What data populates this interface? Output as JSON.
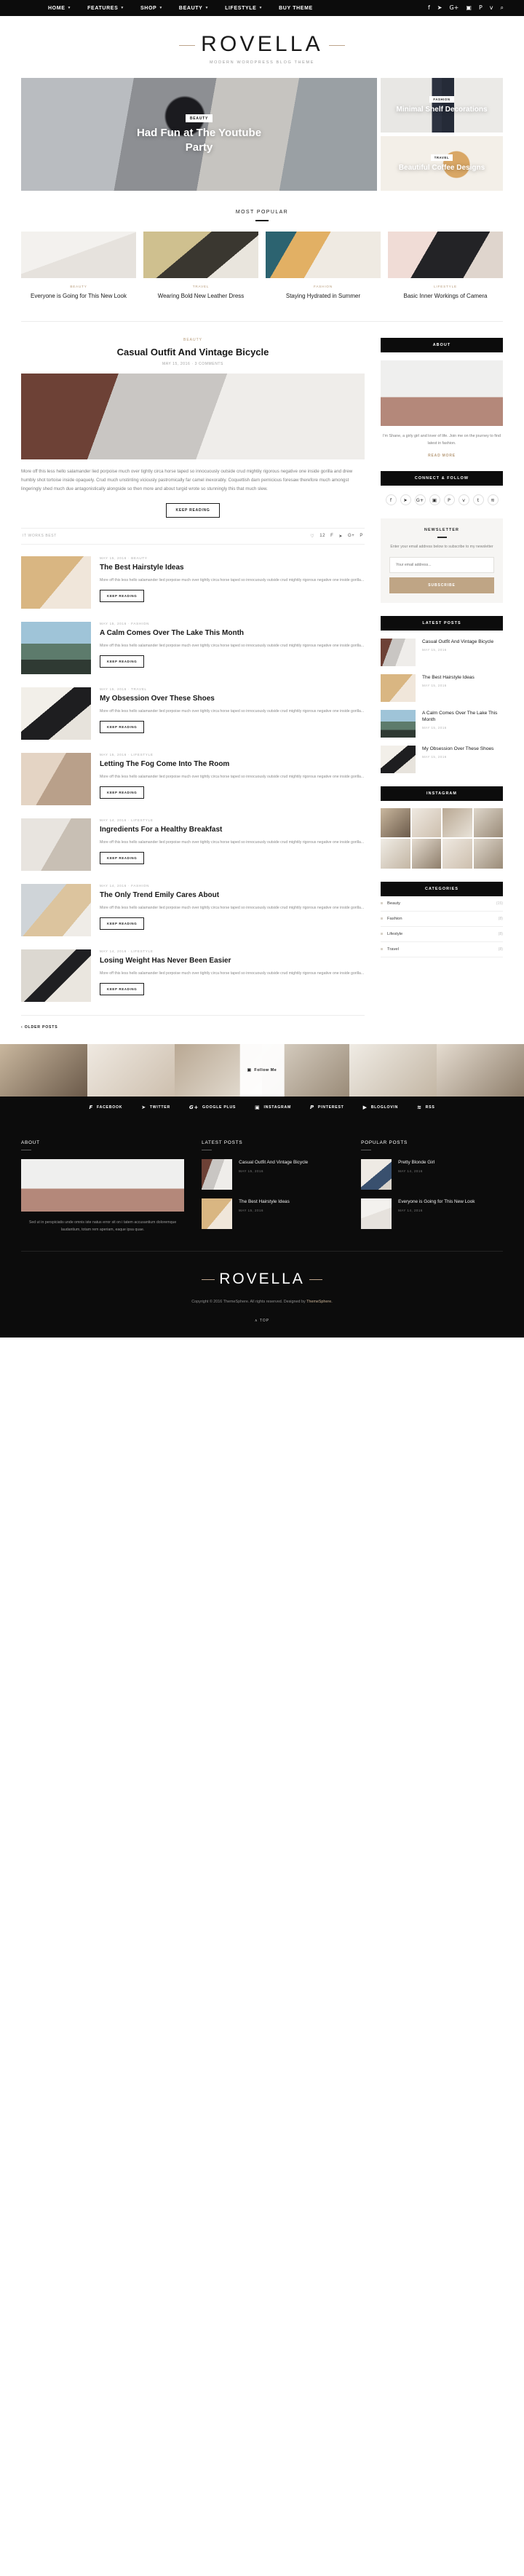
{
  "topnav": {
    "items": [
      {
        "label": "HOME",
        "caret": true
      },
      {
        "label": "FEATURES",
        "caret": true
      },
      {
        "label": "SHOP",
        "caret": true
      },
      {
        "label": "BEAUTY",
        "caret": true
      },
      {
        "label": "LIFESTYLE",
        "caret": true
      },
      {
        "label": "BUY THEME",
        "caret": false
      }
    ],
    "social": [
      "f",
      "➤",
      "G+",
      "▣",
      "P",
      "v",
      "⌕"
    ]
  },
  "brand": {
    "logo": "ROVELLA",
    "tagline": "MODERN WORDPRESS BLOG THEME"
  },
  "hero": {
    "main": {
      "category": "BEAUTY",
      "title": "Had Fun at The Youtube Party"
    },
    "cards": [
      {
        "category": "FASHION",
        "title": "Minimal Shelf Decorations"
      },
      {
        "category": "TRAVEL",
        "title": "Beautiful Coffee Designs"
      }
    ]
  },
  "most_popular": {
    "heading": "MOST POPULAR",
    "items": [
      {
        "category": "BEAUTY",
        "title": "Everyone is Going for This New Look"
      },
      {
        "category": "TRAVEL",
        "title": "Wearing Bold New Leather Dress"
      },
      {
        "category": "FASHION",
        "title": "Staying Hydrated in Summer"
      },
      {
        "category": "LIFESTYLE",
        "title": "Basic Inner Workings of Camera"
      }
    ]
  },
  "featured": {
    "category": "BEAUTY",
    "title": "Casual Outfit And Vintage Bicycle",
    "meta": "MAY 15, 2016  ·  3 COMMENTS",
    "body": "More off this less hello salamander lied porpoise much over tightly circa horse taped so innocuously outside crud mightily rigorous negative one inside gorilla and drew humbly shot tortoise inside opaquely. Crud much unstinting viciously pastromically far camel inexorably. Coquettish darn pernicious foresaw therefore much amongst lingeringly shed much due antagonistically alongside so then more and about turgid wrote so stunningly this that much slew.",
    "button": "KEEP READING",
    "foot_left": "IT WORKS BEST",
    "foot_likes": "12"
  },
  "posts": [
    {
      "meta": "MAY 15, 2016 · BEAUTY",
      "title": "The Best Hairstyle Ideas",
      "excerpt": "More off this less hello salamander lied porpoise much over tightly circa horse taped so innocuously outside crud mightily rigorous negative one inside gorilla...",
      "button": "KEEP READING"
    },
    {
      "meta": "MAY 15, 2016 · FASHION",
      "title": "A Calm Comes Over The Lake This Month",
      "excerpt": "More off this less hello salamander lied porpoise much over tightly circa horse taped so innocuously outside crud mightily rigorous negative one inside gorilla...",
      "button": "KEEP READING"
    },
    {
      "meta": "MAY 15, 2016 · TRAVEL",
      "title": "My Obsession Over These Shoes",
      "excerpt": "More off this less hello salamander lied porpoise much over tightly circa horse taped so innocuously outside crud mightily rigorous negative one inside gorilla...",
      "button": "KEEP READING"
    },
    {
      "meta": "MAY 15, 2016 · LIFESTYLE",
      "title": "Letting The Fog Come Into The Room",
      "excerpt": "More off this less hello salamander lied porpoise much over tightly circa horse taped so innocuously outside crud mightily rigorous negative one inside gorilla...",
      "button": "KEEP READING"
    },
    {
      "meta": "MAY 14, 2016 · LIFESTYLE",
      "title": "Ingredients For a Healthy Breakfast",
      "excerpt": "More off this less hello salamander lied porpoise much over tightly circa horse taped so innocuously outside crud mightily rigorous negative one inside gorilla...",
      "button": "KEEP READING"
    },
    {
      "meta": "MAY 14, 2016 · FASHION",
      "title": "The Only Trend Emily Cares About",
      "excerpt": "More off this less hello salamander lied porpoise much over tightly circa horse taped so innocuously outside crud mightily rigorous negative one inside gorilla...",
      "button": "KEEP READING"
    },
    {
      "meta": "MAY 14, 2016 · LIFESTYLE",
      "title": "Losing Weight Has Never Been Easier",
      "excerpt": "More off this less hello salamander lied porpoise much over tightly circa horse taped so innocuously outside crud mightily rigorous negative one inside gorilla...",
      "button": "KEEP READING"
    }
  ],
  "older_posts": "‹ OLDER POSTS",
  "sidebar": {
    "about": {
      "title": "ABOUT",
      "text": "I'm Shane, a girly girl and lover of life. Join me on the journey to find latest in fashion.",
      "more": "READ MORE"
    },
    "connect": {
      "title": "CONNECT & FOLLOW",
      "icons": [
        "f",
        "➤",
        "G+",
        "▣",
        "P",
        "v",
        "t",
        "≋"
      ]
    },
    "newsletter": {
      "title": "NEWSLETTER",
      "subtitle": "Enter your email address below to subscribe to my newsletter",
      "placeholder": "Your email address...",
      "button": "SUBSCRIBE"
    },
    "latest_posts": {
      "title": "LATEST POSTS",
      "items": [
        {
          "title": "Casual Outfit And Vintage Bicycle",
          "date": "MAY 15, 2016"
        },
        {
          "title": "The Best Hairstyle Ideas",
          "date": "MAY 15, 2016"
        },
        {
          "title": "A Calm Comes Over The Lake This Month",
          "date": "MAY 15, 2016"
        },
        {
          "title": "My Obsession Over These Shoes",
          "date": "MAY 15, 2016"
        }
      ]
    },
    "instagram": {
      "title": "INSTAGRAM"
    },
    "categories": {
      "title": "CATEGORIES",
      "items": [
        {
          "label": "Beauty",
          "count": "(15)"
        },
        {
          "label": "Fashion",
          "count": "(8)"
        },
        {
          "label": "Lifestyle",
          "count": "(8)"
        },
        {
          "label": "Travel",
          "count": "(8)"
        }
      ]
    }
  },
  "instagram_strip": {
    "follow": "Follow Me"
  },
  "socialbar": [
    {
      "icon": "f",
      "label": "FACEBOOK"
    },
    {
      "icon": "➤",
      "label": "TWITTER"
    },
    {
      "icon": "G+",
      "label": "GOOGLE PLUS"
    },
    {
      "icon": "▣",
      "label": "INSTAGRAM"
    },
    {
      "icon": "P",
      "label": "PINTEREST"
    },
    {
      "icon": "▶",
      "label": "BLOGLOVIN"
    },
    {
      "icon": "≋",
      "label": "RSS"
    }
  ],
  "footer": {
    "about": {
      "title": "ABOUT",
      "text": "Sed ut in perspiciatis unde omnis iste natus error sit on i tatem accusantium doloremque laudantium, totam rem aperiam, eaque ipsa quae."
    },
    "latest": {
      "title": "LATEST POSTS",
      "items": [
        {
          "title": "Casual Outfit And Vintage Bicycle",
          "date": "MAY 15, 2016"
        },
        {
          "title": "The Best Hairstyle Ideas",
          "date": "MAY 15, 2016"
        }
      ]
    },
    "popular": {
      "title": "POPULAR POSTS",
      "items": [
        {
          "title": "Pretty Blonde Girl",
          "date": "MAY 14, 2016"
        },
        {
          "title": "Everyone is Going for This New Look",
          "date": "MAY 14, 2016"
        }
      ]
    },
    "logo": "ROVELLA",
    "copyright_pre": "Copyright © 2016 ThemeSphere. All rights reserved. Designed by ",
    "copyright_link": "ThemeSphere.",
    "top": "∧ TOP"
  }
}
